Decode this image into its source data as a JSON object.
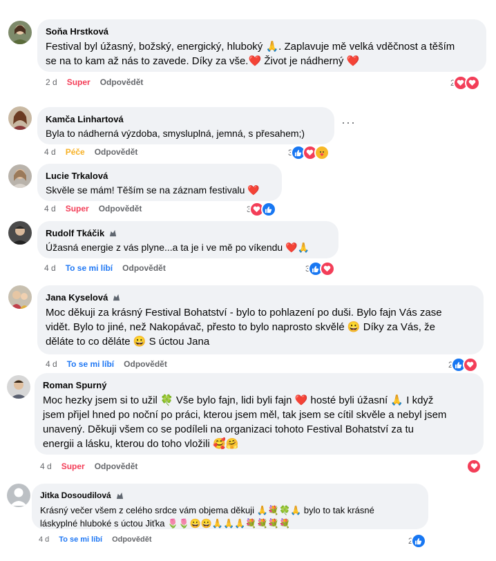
{
  "comments": [
    {
      "author": "Soňa Hrstková",
      "lines": [
        "Festival byl úžasný, božský, energický, hluboký 🙏. Zaplavuje mě velká vděčnost a těším",
        "se na to kam až nás to zavede. Díky za vše.❤️ Život je nádherný ❤️"
      ],
      "time": "2 d",
      "reaction": "Super",
      "reply": "Odpovědět",
      "count": "2",
      "icons": [
        "love",
        "love"
      ]
    },
    {
      "author": "Kamča Linhartová",
      "lines": [
        "Byla to nádherná výzdoba, smysluplná, jemná, s přesahem;)"
      ],
      "time": "4 d",
      "reaction": "Péče",
      "reply": "Odpovědět",
      "count": "3",
      "icons": [
        "like",
        "love",
        "care"
      ],
      "more": "···"
    },
    {
      "author": "Lucie Trkalová",
      "lines": [
        "Skvěle se mám! Těším se na záznam festivalu ❤️"
      ],
      "time": "4 d",
      "reaction": "Super",
      "reply": "Odpovědět",
      "count": "3",
      "icons": [
        "love",
        "like"
      ]
    },
    {
      "author": "Rudolf Tkáčik",
      "lines": [
        "Úžasná energie z vás plyne...a ta je i ve mě po víkendu ❤️🙏"
      ],
      "time": "4 d",
      "reaction": "To se mi líbí",
      "reply": "Odpovědět",
      "count": "3",
      "icons": [
        "like",
        "love"
      ]
    },
    {
      "author": "Jana Kyselová",
      "lines": [
        "Moc děkuji za krásný Festival Bohatství - bylo to pohlazení po duši. Bylo fajn Vás zase",
        "vidět. Bylo to jiné, než Nakopávač, přesto to bylo naprosto skvělé 😀 Díky za Vás, že",
        "děláte to co děláte 😀 S úctou Jana"
      ],
      "time": "4 d",
      "reaction": "To se mi líbí",
      "reply": "Odpovědět",
      "count": "2",
      "icons": [
        "like",
        "love"
      ]
    },
    {
      "author": "Roman Spurný",
      "lines": [
        "Moc hezky jsem si to užil 🍀 Vše bylo fajn, lidi byli fajn ❤️ hosté byli úžasní 🙏 I když",
        "jsem přijel hned po noční po práci, kterou jsem měl, tak jsem se cítil skvěle a nebyl jsem",
        "unavený. Děkuji všem co se podíleli na organizaci tohoto Festival Bohatství za tu",
        "energii a lásku, kterou do toho vložili 🥰🤗"
      ],
      "time": "4 d",
      "reaction": "Super",
      "reply": "Odpovědět",
      "count": "",
      "icons": [
        "love"
      ]
    },
    {
      "author": "Jitka Dosoudilová",
      "lines": [
        "Krásný večer všem z celého srdce vám objema děkuji 🙏💐🍀🙏 bylo to tak krásné",
        "láskyplné hluboké s úctou Jiťka 🌷🌷😀😀🙏🙏🙏💐💐💐💐"
      ],
      "time": "4 d",
      "reaction": "To se mi líbí",
      "reply": "Odpovědět",
      "count": "2",
      "icons": [
        "like"
      ]
    }
  ]
}
